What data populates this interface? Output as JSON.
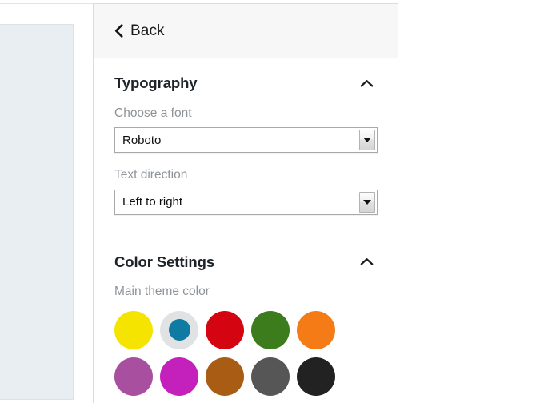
{
  "panel": {
    "header": {
      "back_label": "Back",
      "back_icon": "chevron-left-icon"
    },
    "sections": [
      {
        "id": "typography",
        "title": "Typography",
        "collapse_icon": "chevron-up-icon",
        "fields": [
          {
            "id": "font",
            "label": "Choose a font",
            "value": "Roboto",
            "control": "select",
            "arrow_icon": "caret-down-icon"
          },
          {
            "id": "text-direction",
            "label": "Text direction",
            "value": "Left to right",
            "control": "select",
            "arrow_icon": "caret-down-icon"
          }
        ]
      },
      {
        "id": "color-settings",
        "title": "Color Settings",
        "collapse_icon": "chevron-up-icon",
        "fields": [
          {
            "id": "main-theme-color",
            "label": "Main theme color",
            "control": "swatch-grid"
          }
        ]
      }
    ]
  },
  "theme_colors": {
    "selected_index": 1,
    "selected_ring": "#e0e2e3",
    "swatches": [
      {
        "name": "yellow",
        "hex": "#f5e400"
      },
      {
        "name": "teal",
        "hex": "#0f7ba2"
      },
      {
        "name": "red",
        "hex": "#d40511"
      },
      {
        "name": "green",
        "hex": "#3d7c1c"
      },
      {
        "name": "orange",
        "hex": "#f47b15"
      },
      {
        "name": "purple",
        "hex": "#a94fa0"
      },
      {
        "name": "magenta",
        "hex": "#c421bc"
      },
      {
        "name": "brown",
        "hex": "#a85c14"
      },
      {
        "name": "gray",
        "hex": "#565656"
      },
      {
        "name": "black",
        "hex": "#222222"
      }
    ]
  }
}
